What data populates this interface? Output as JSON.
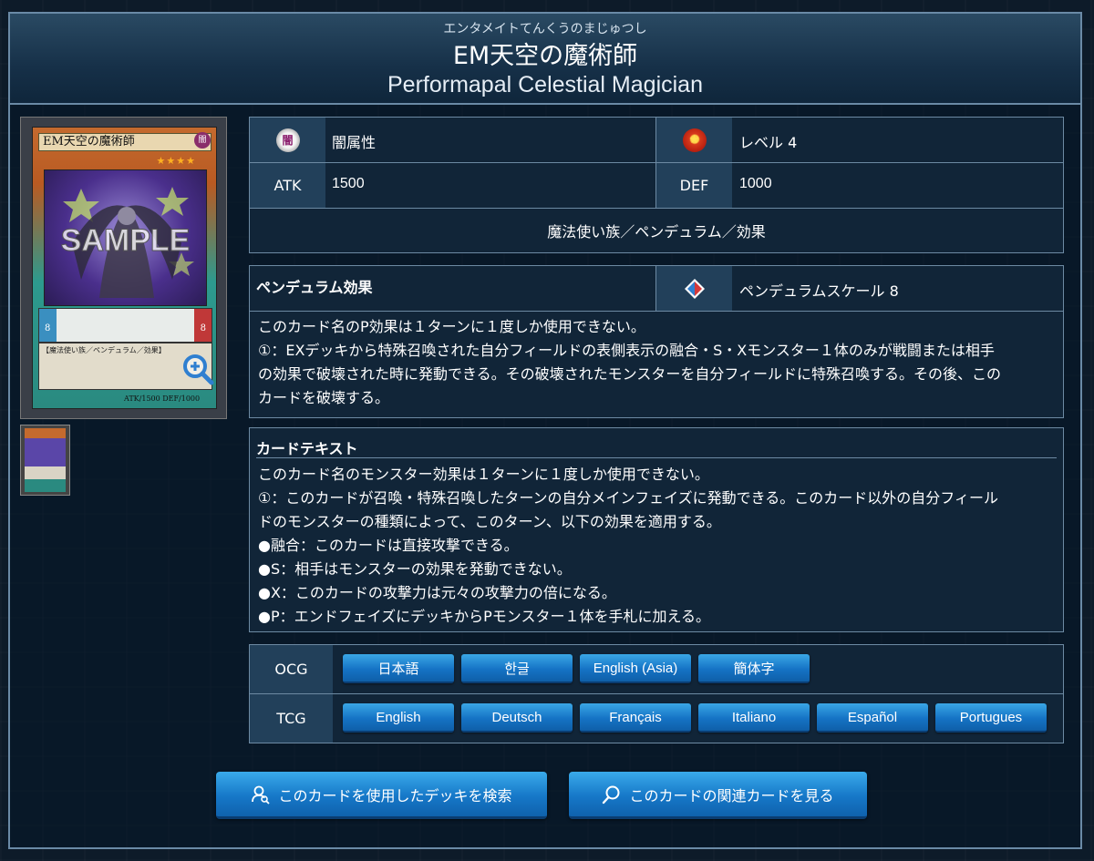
{
  "header": {
    "ruby": "エンタメイトてんくうのまじゅつし",
    "jp_name": "EM天空の魔術師",
    "en_name": "Performapal Celestial Magician"
  },
  "card_image": {
    "title": "EM天空の魔術師",
    "attribute_glyph": "闇",
    "stars": "★★★★",
    "watermark": "SAMPLE",
    "scale_left": "8",
    "scale_right": "8",
    "type_line": "【魔法使い族／ペンデュラム／効果】",
    "stat_line": "ATK/1500  DEF/1000"
  },
  "stats": {
    "attribute_glyph": "闇",
    "attribute": "闇属性",
    "level": "レベル 4",
    "atk_label": "ATK",
    "atk": "1500",
    "def_label": "DEF",
    "def": "1000",
    "types": "魔法使い族／ペンデュラム／効果"
  },
  "pendulum": {
    "title": "ペンデュラム効果",
    "scale": "ペンデュラムスケール 8",
    "lines": [
      "このカード名のP効果は１ターンに１度しか使用できない。",
      "①：EXデッキから特殊召喚された自分フィールドの表側表示の融合・S・Xモンスター１体のみが戦闘または相手",
      "の効果で破壊された時に発動できる。その破壊されたモンスターを自分フィールドに特殊召喚する。その後、この",
      "カードを破壊する。"
    ]
  },
  "card_text": {
    "title": "カードテキスト",
    "lines": [
      "このカード名のモンスター効果は１ターンに１度しか使用できない。",
      "①：このカードが召喚・特殊召喚したターンの自分メインフェイズに発動できる。このカード以外の自分フィール",
      "ドのモンスターの種類によって、このターン、以下の効果を適用する。",
      "●融合：このカードは直接攻撃できる。",
      "●S：相手はモンスターの効果を発動できない。",
      "●X：このカードの攻撃力は元々の攻撃力の倍になる。",
      "●P：エンドフェイズにデッキからPモンスター１体を手札に加える。"
    ]
  },
  "languages": {
    "ocg_label": "OCG",
    "ocg": [
      "日本語",
      "한글",
      "English (Asia)",
      "簡体字"
    ],
    "tcg_label": "TCG",
    "tcg": [
      "English",
      "Deutsch",
      "Français",
      "Italiano",
      "Español",
      "Portugues"
    ]
  },
  "actions": {
    "deck_search": "このカードを使用したデッキを検索",
    "related_cards": "このカードの関連カードを見る"
  },
  "colors": {
    "accent_button": "#1678c8",
    "panel_bg": "#112538",
    "label_bg": "#22405a",
    "border": "#6d8aa3"
  }
}
